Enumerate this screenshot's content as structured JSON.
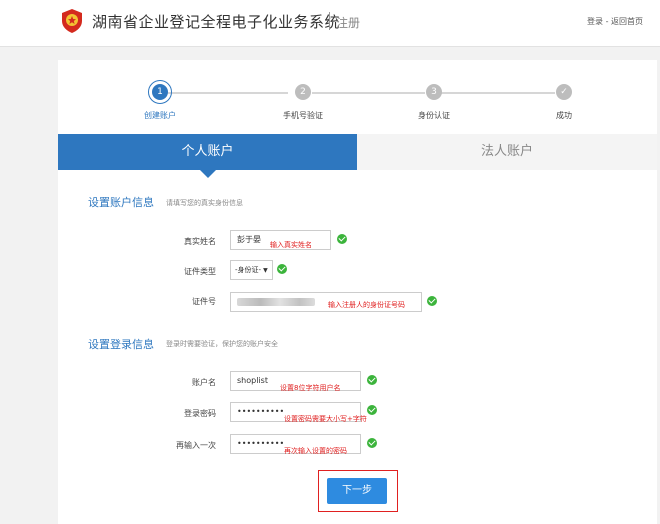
{
  "header": {
    "site_title": "湖南省企业登记全程电子化业务系统",
    "page_label": "注册",
    "links": {
      "login": "登录",
      "separator": "-",
      "home": "返回首页"
    }
  },
  "steps": [
    {
      "number": "1",
      "label": "创建账户",
      "state": "active"
    },
    {
      "number": "2",
      "label": "手机号验证",
      "state": "pending"
    },
    {
      "number": "3",
      "label": "身份认证",
      "state": "pending"
    },
    {
      "number": "✓",
      "label": "成功",
      "state": "pending"
    }
  ],
  "tabs": {
    "personal": "个人账户",
    "company": "法人账户",
    "selected": "personal"
  },
  "account_info": {
    "title": "设置账户信息",
    "hint": "请填写您的真实身份信息",
    "name_label": "真实姓名",
    "name_value": "彭于晏",
    "name_annotation": "输入真实姓名",
    "id_type_label": "证件类型",
    "id_type_value": "-身份证-",
    "id_number_label": "证件号",
    "id_number_annotation": "输入注册人的身份证号码"
  },
  "login_info": {
    "title": "设置登录信息",
    "hint": "登录时需要验证，保护您的账户安全",
    "username_label": "账户名",
    "username_value": "shoplist",
    "username_annotation": "设置8位字符用户名",
    "password_label": "登录密码",
    "password_value": "••••••••••",
    "password_annotation": "设置密码需要大小写+字符",
    "confirm_label": "再输入一次",
    "confirm_value": "••••••••••",
    "confirm_annotation": "再次输入设置的密码"
  },
  "actions": {
    "next": "下一步"
  },
  "colors": {
    "primary": "#2e77bf",
    "annotation": "#e02020",
    "success": "#3cb43c"
  }
}
